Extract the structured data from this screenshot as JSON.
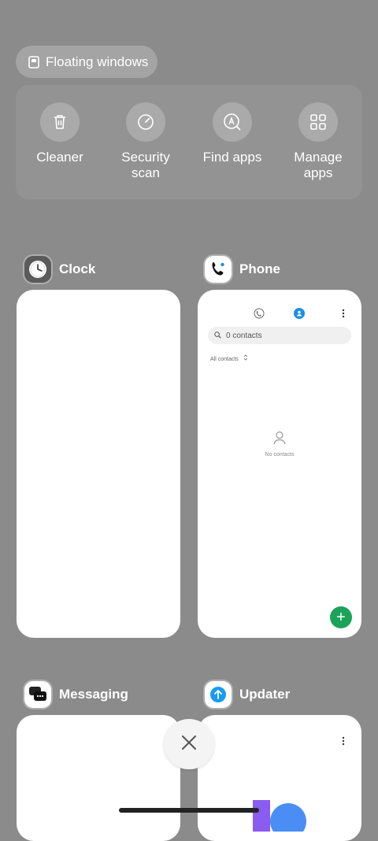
{
  "floating_windows": {
    "label": "Floating windows",
    "icon": "floating-window-icon"
  },
  "tools": [
    {
      "label": "Cleaner",
      "icon": "trash-icon"
    },
    {
      "label": "Security\nscan",
      "icon": "security-gauge-icon"
    },
    {
      "label": "Find apps",
      "icon": "find-apps-icon"
    },
    {
      "label": "Manage\napps",
      "icon": "grid-apps-icon"
    }
  ],
  "recent_apps": [
    {
      "name": "Clock",
      "icon": "clock-icon"
    },
    {
      "name": "Phone",
      "icon": "phone-icon"
    },
    {
      "name": "Messaging",
      "icon": "messaging-icon"
    },
    {
      "name": "Updater",
      "icon": "updater-icon"
    }
  ],
  "phone_preview": {
    "search_placeholder": "0 contacts",
    "filter_label": "All contacts",
    "empty_text": "No contacts",
    "fab_label": "+"
  },
  "colors": {
    "background": "#8b8b8b",
    "fab": "#1ca35a",
    "contacts_tab": "#1a8fe3"
  }
}
